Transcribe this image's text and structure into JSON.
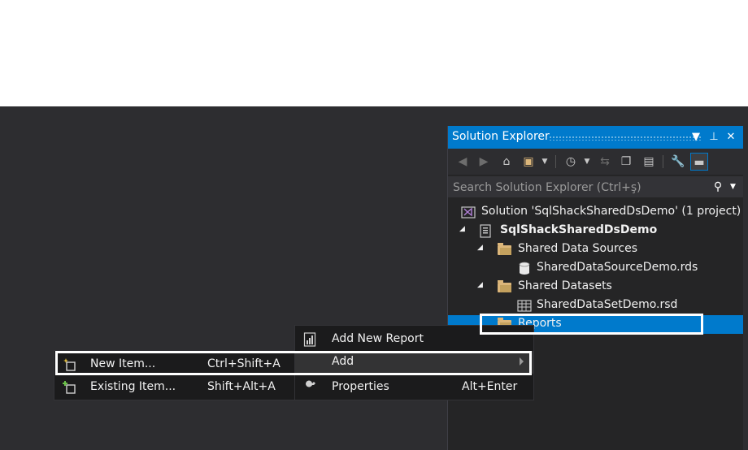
{
  "solution_explorer": {
    "title": "Solution Explorer",
    "title_buttons": {
      "dropdown": "▼",
      "pin": "⊥",
      "close": "✕"
    },
    "search_placeholder": "Search Solution Explorer (Ctrl+ş)",
    "toolbar_icons": [
      "back-icon",
      "forward-icon",
      "home-icon",
      "switch-views-icon",
      "pending-changes-filter-icon",
      "sync-icon",
      "collapse-all-icon",
      "show-all-files-icon",
      "properties-icon",
      "preview-icon"
    ],
    "tree": [
      {
        "label": "Solution 'SqlShackSharedDsDemo' (1 project)",
        "icon": "solution-icon"
      },
      {
        "label": "SqlShackSharedDsDemo",
        "icon": "project-icon"
      },
      {
        "label": "Shared Data Sources",
        "icon": "folder-icon"
      },
      {
        "label": "SharedDataSourceDemo.rds",
        "icon": "datasource-icon"
      },
      {
        "label": "Shared Datasets",
        "icon": "folder-icon"
      },
      {
        "label": "SharedDataSetDemo.rsd",
        "icon": "dataset-icon"
      },
      {
        "label": "Reports",
        "icon": "folder-icon"
      }
    ]
  },
  "context_menu": {
    "items": [
      {
        "label": "Add New Report",
        "shortcut": ""
      },
      {
        "label": "Add",
        "shortcut": ""
      },
      {
        "label": "Properties",
        "shortcut": "Alt+Enter"
      }
    ]
  },
  "add_submenu": {
    "items": [
      {
        "label": "New Item...",
        "shortcut": "Ctrl+Shift+A"
      },
      {
        "label": "Existing Item...",
        "shortcut": "Shift+Alt+A"
      }
    ]
  },
  "colors": {
    "accent": "#007acc",
    "background": "#2d2d30",
    "highlight_border": "#ffffff"
  }
}
